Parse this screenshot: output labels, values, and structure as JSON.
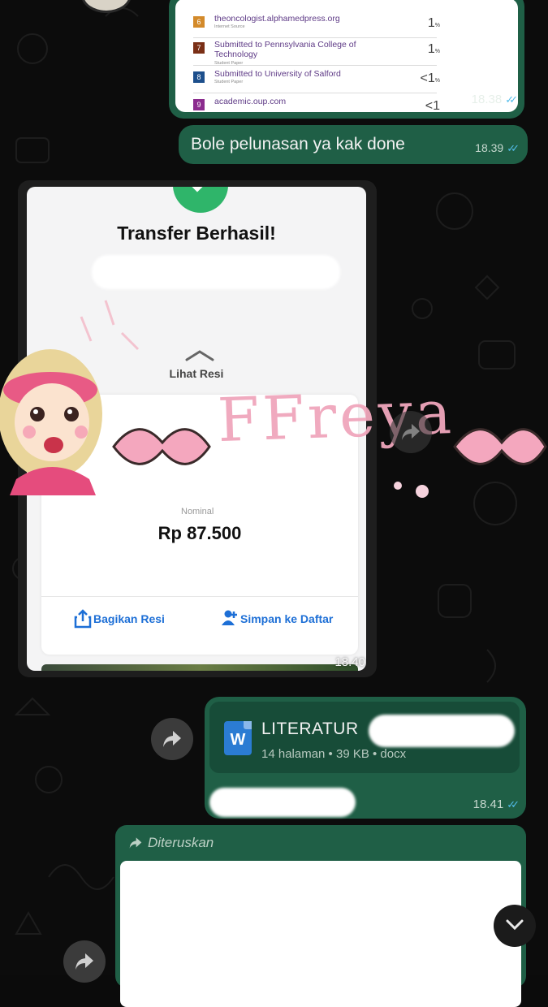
{
  "report": {
    "rows": [
      {
        "num": "6",
        "color": "#d38a2a",
        "title": "theoncologist.alphamedpress.org",
        "subtitle": "Internet Source",
        "pct": "1",
        "unit": "%"
      },
      {
        "num": "7",
        "color": "#7a2f16",
        "title": "Submitted to Pennsylvania College of Technology",
        "subtitle": "Student Paper",
        "pct": "1",
        "unit": "%"
      },
      {
        "num": "8",
        "color": "#1d4f8c",
        "title": "Submitted to University of Salford",
        "subtitle": "Student Paper",
        "pct": "<1",
        "unit": "%"
      },
      {
        "num": "9",
        "color": "#8b2c8e",
        "title": "academic.oup.com",
        "subtitle": "",
        "pct": "<1",
        "unit": ""
      }
    ],
    "time": "18.38"
  },
  "text_message": {
    "text": "Bole pelunasan ya kak done",
    "time": "18.39"
  },
  "transfer": {
    "title": "Transfer Berhasil!",
    "lihat_resi": "Lihat Resi",
    "nominal_label": "Nominal",
    "amount": "Rp 87.500",
    "share_label": "Bagikan Resi",
    "save_label": "Simpan ke Daftar",
    "time": "18.40"
  },
  "sticker": {
    "text": "FFreya"
  },
  "document": {
    "name": "LITERATUR",
    "meta": "14 halaman • 39 KB • docx",
    "icon_letter": "W",
    "time": "18.41"
  },
  "forwarded": {
    "label": "Diteruskan"
  },
  "icons": [
    "check-icon",
    "forward-icon",
    "share-icon",
    "add-contact-icon",
    "word-icon",
    "chevron-down-icon"
  ],
  "colors": {
    "outgoing_bubble": "#1f5f46",
    "accent_blue": "#1d6fd6",
    "read_ticks": "#53bdeb",
    "success_green": "#2fb56a"
  }
}
